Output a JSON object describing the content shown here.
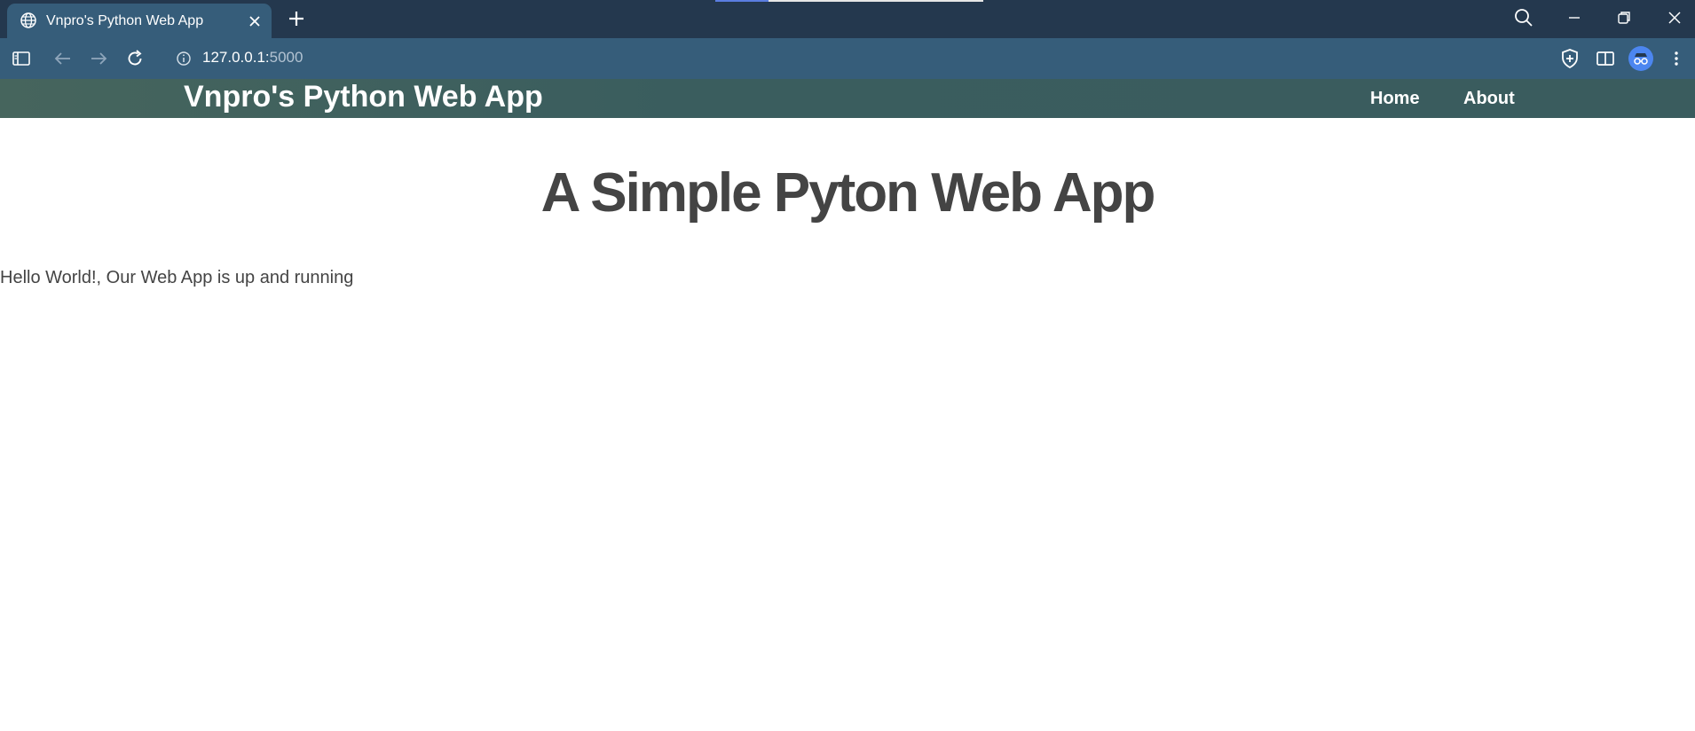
{
  "browser": {
    "tab": {
      "title": "Vnpro's Python Web App",
      "icon": "globe-icon",
      "close_icon": "close-icon"
    },
    "new_tab_icon": "plus-icon",
    "window_controls": [
      "search-icon",
      "minimize-icon",
      "restore-icon",
      "close-icon"
    ],
    "toolbar": {
      "icons": [
        "sidebar-icon",
        "back-arrow-icon",
        "forward-arrow-icon",
        "reload-icon"
      ],
      "url_host": "127.0.0.1:",
      "url_port": "5000",
      "right_icons": [
        "shield-plus-icon",
        "split-view-icon",
        "profile-avatar",
        "more-menu-icon"
      ]
    }
  },
  "site": {
    "brand": "Vnpro's Python Web App",
    "nav": {
      "home": "Home",
      "about": "About"
    },
    "headline": "A Simple Pyton Web App",
    "message": "Hello World!, Our Web App is up and running"
  },
  "colors": {
    "titlebar": "#24384e",
    "toolbar": "#365d7a",
    "site_nav": "#3a5d5e",
    "text": "#444444",
    "avatar": "#4c86f0"
  }
}
